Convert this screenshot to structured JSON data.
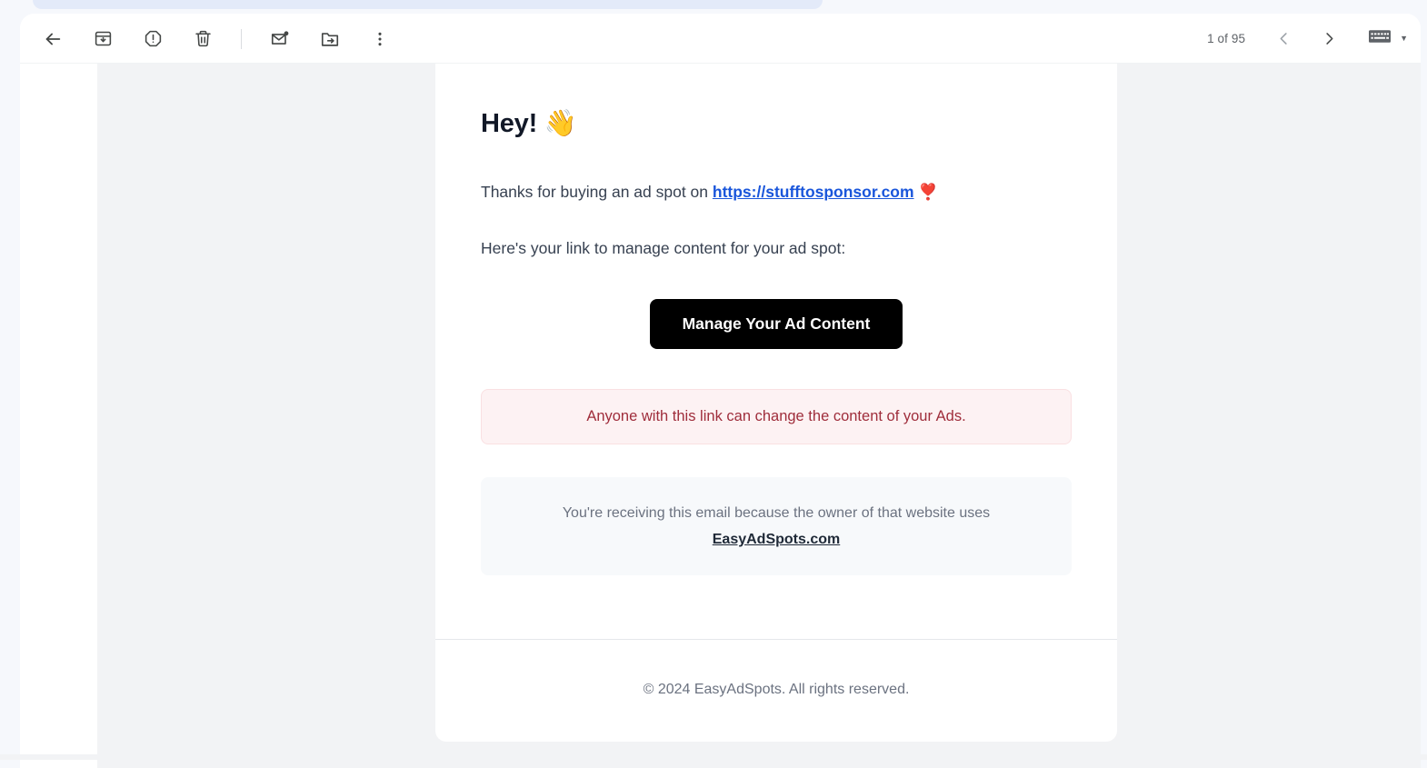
{
  "window": {
    "background_color": "#f6f8fc",
    "panel_color": "#ffffff",
    "message_backdrop_color": "#f2f3f5"
  },
  "toolbar": {
    "back_label": "Back to Inbox",
    "actions": [
      {
        "name": "back-icon",
        "label": "Back"
      },
      {
        "name": "archive-icon",
        "label": "Archive"
      },
      {
        "name": "report-spam-icon",
        "label": "Report spam"
      },
      {
        "name": "delete-icon",
        "label": "Delete"
      },
      {
        "name": "mark-unread-icon",
        "label": "Mark as unread"
      },
      {
        "name": "move-to-folder-icon",
        "label": "Move to"
      },
      {
        "name": "more-options-icon",
        "label": "More"
      }
    ],
    "pagination": {
      "count_text": "1 of 95",
      "previous_label": "Older",
      "next_label": "Newer"
    },
    "keyboard": {
      "icon": "keyboard-icon",
      "caret": "▼"
    }
  },
  "email": {
    "heading": "Hey!",
    "heading_emoji": "👋",
    "intro_prefix": "Thanks for buying an ad spot on ",
    "sponsor_link_text": "https://stufftosponsor.com",
    "intro_emoji": "❣️",
    "manage_text": "Here's your link to manage content for your ad spot:",
    "cta_label": "Manage Your Ad Content",
    "warning_text": "Anyone with this link can change the content of your Ads.",
    "notice_text": "You're receiving this email because the owner of that website uses",
    "notice_link_text": "EasyAdSpots.com",
    "copyright": "© 2024 EasyAdSpots. All rights reserved.",
    "colors": {
      "link": "#1a56db",
      "cta_background": "#000000",
      "cta_text": "#ffffff",
      "warning_background": "#fdf2f3",
      "warning_border": "#fae0e2",
      "warning_text": "#9f2d3b",
      "notice_background": "#f7f9fb"
    }
  }
}
